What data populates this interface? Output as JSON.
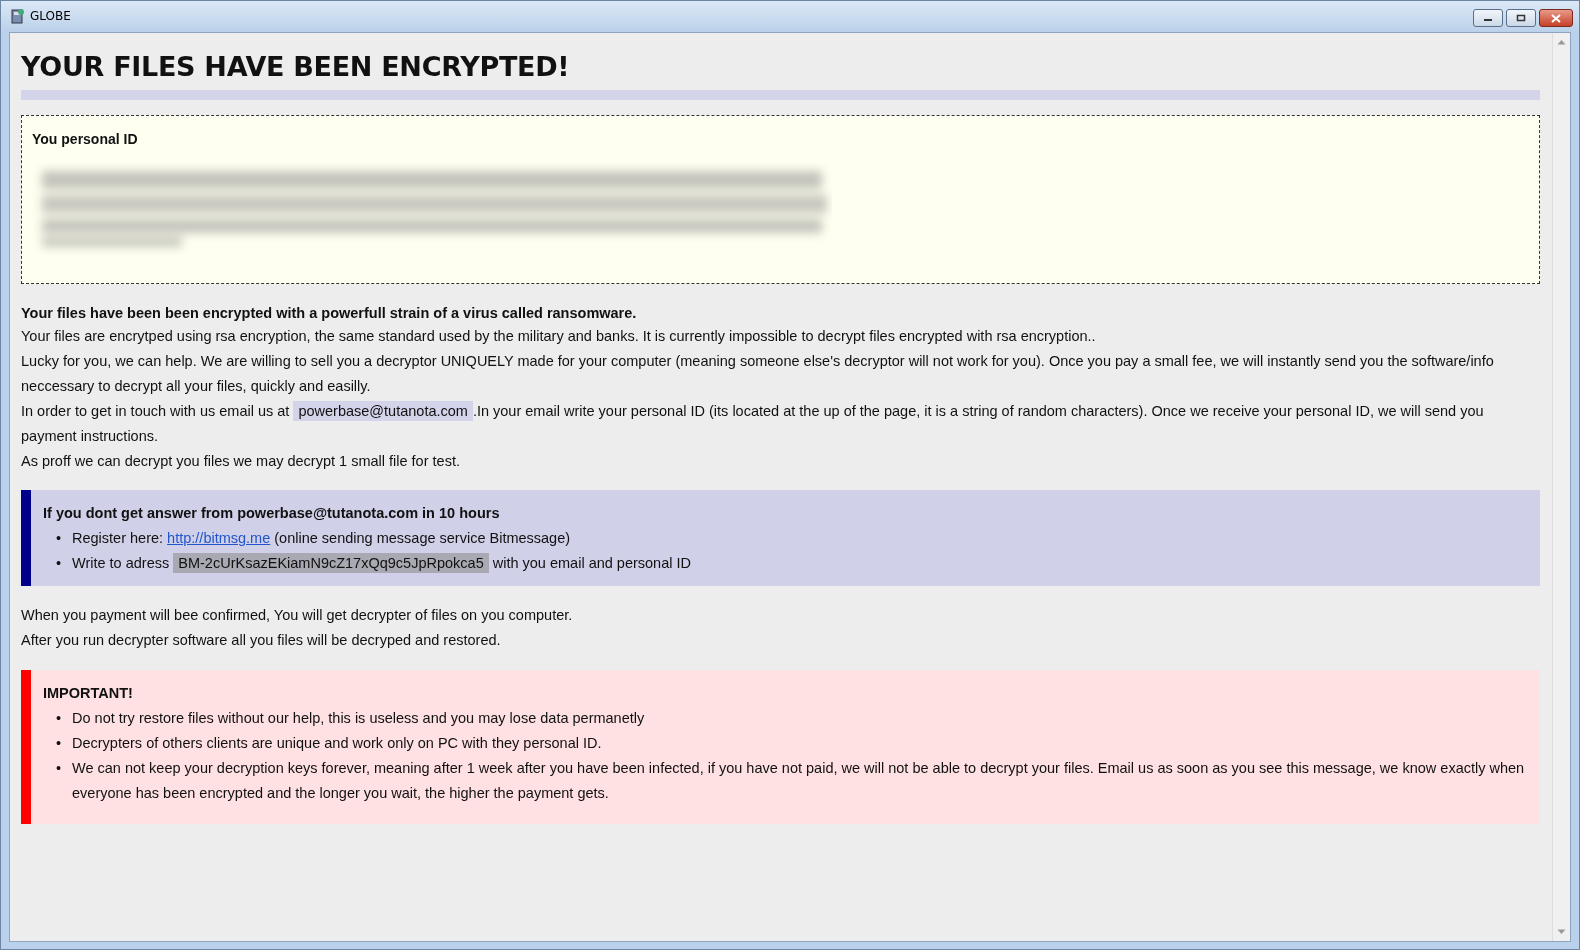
{
  "window": {
    "title": "GLOBE"
  },
  "heading": "YOUR FILES HAVE BEEN ENCRYPTED!",
  "id_box": {
    "label": "You personal ID"
  },
  "lead": "Your files have been been encrypted with a powerfull strain of a virus called ransomware.",
  "paragraphs": [
    {
      "kind": "plain",
      "text": "Your files are encrytped using rsa encryption, the same standard used by the military and banks. It is currently impossible to decrypt files encrypted with rsa encryption.."
    },
    {
      "kind": "plain",
      "text": "Lucky for you, we can help. We are willing to sell you a decryptor UNIQUELY made for your computer (meaning someone else's decryptor will not work for you). Once you pay a small fee, we will instantly send you the software/info neccessary to decrypt all your files, quickly and easilly."
    },
    {
      "kind": "contact",
      "before": "In order to get in touch with us email us at",
      "email": "powerbase@tutanota.com",
      "after": ".In your email write your personal ID (its located at the up of the page, it is a string of random characters). Once we receive your personal ID, we will send you payment instructions."
    },
    {
      "kind": "plain",
      "text": "As proff we can decrypt you files we may decrypt 1 small file for test."
    }
  ],
  "info_box": {
    "kind": "info",
    "title": "If you dont get answer from powerbase@tutanota.com in 10 hours",
    "items": [
      {
        "kind": "link",
        "marker": "•",
        "before": "Register here:",
        "value": "http://bitmsg.me",
        "after": "(online sending message service Bitmessage)"
      },
      {
        "kind": "code",
        "marker": "•",
        "before": "Write to adress",
        "value": "BM-2cUrKsazEKiamN9cZ17xQq9c5JpRpokca5",
        "after": "with you email and personal ID"
      }
    ]
  },
  "after_paragraphs": [
    "When you payment will bee confirmed, You will get decrypter of files on you computer.",
    "After you run decrypter software all you files will be decryped and restored."
  ],
  "important_box": {
    "kind": "warning",
    "title": "IMPORTANT!",
    "items": [
      {
        "marker": "•",
        "text": "Do not try restore files without our help, this is useless and you may lose data permanetly"
      },
      {
        "marker": "•",
        "text": "Decrypters of others clients are unique and work only on PC with they personal ID."
      },
      {
        "marker": "•",
        "text": "We can not keep your decryption keys forever, meaning after 1 week after you have been infected, if you have not paid, we will not be able to decrypt your files. Email us as soon as you see this message, we know exactly when everyone has been encrypted and the longer you wait, the higher the payment gets."
      }
    ]
  }
}
